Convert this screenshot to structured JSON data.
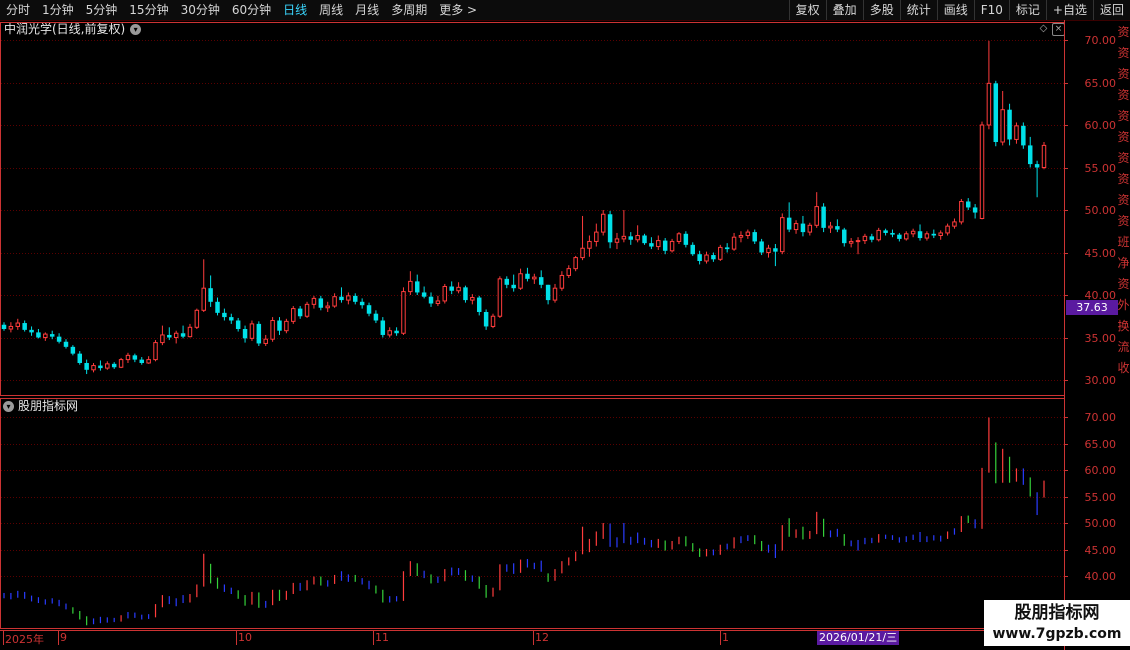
{
  "toolbar": {
    "left": [
      "分时",
      "1分钟",
      "5分钟",
      "15分钟",
      "30分钟",
      "60分钟",
      "日线",
      "周线",
      "月线",
      "多周期",
      "更多 >"
    ],
    "active_index": 6,
    "right": [
      "复权",
      "叠加",
      "多股",
      "统计",
      "画线",
      "F10",
      "标记",
      "+自选",
      "返回"
    ]
  },
  "main_chart": {
    "title": "中润光学(日线,前复权)",
    "price_tag": "37.63",
    "yticks": [
      "70.00",
      "65.00",
      "60.00",
      "55.00",
      "50.00",
      "45.00",
      "40.00",
      "35.00",
      "30.00"
    ]
  },
  "indicator": {
    "title": "股朋指标网",
    "yticks": [
      "70.00",
      "65.00",
      "60.00",
      "55.00",
      "50.00",
      "45.00",
      "40.00"
    ]
  },
  "side_strip": [
    "资",
    "资",
    "资",
    "资",
    "资",
    "资",
    "资",
    "资",
    "资",
    "资",
    "班",
    "净",
    "资",
    "外",
    "换",
    "流",
    "收"
  ],
  "timeline": {
    "labels": [
      "2025年",
      "9",
      "10",
      "11",
      "12",
      "1"
    ],
    "cursor_date": "2026/01/21/三"
  },
  "watermark": {
    "line1": "股朋指标网",
    "line2": "www.7gpzb.com"
  },
  "colors": {
    "up": "#ff3c3c",
    "down": "#00e0e8",
    "axis": "#cc3333",
    "grid": "#5a0000",
    "tag": "#5a1aa0"
  },
  "chart_data": {
    "type": "candlestick",
    "ylim": [
      29,
      71
    ],
    "candles": [
      {
        "o": 36.5,
        "h": 36.8,
        "l": 35.8,
        "c": 36.0
      },
      {
        "o": 36.0,
        "h": 36.8,
        "l": 35.6,
        "c": 36.3
      },
      {
        "o": 36.3,
        "h": 37.2,
        "l": 35.9,
        "c": 36.7
      },
      {
        "o": 36.7,
        "h": 37.0,
        "l": 35.7,
        "c": 35.9
      },
      {
        "o": 35.9,
        "h": 36.3,
        "l": 35.2,
        "c": 35.6
      },
      {
        "o": 35.6,
        "h": 36.0,
        "l": 34.9,
        "c": 35.0
      },
      {
        "o": 35.0,
        "h": 35.6,
        "l": 34.6,
        "c": 35.4
      },
      {
        "o": 35.4,
        "h": 35.8,
        "l": 34.8,
        "c": 35.1
      },
      {
        "o": 35.1,
        "h": 35.5,
        "l": 34.3,
        "c": 34.5
      },
      {
        "o": 34.5,
        "h": 34.8,
        "l": 33.7,
        "c": 33.9
      },
      {
        "o": 33.9,
        "h": 34.1,
        "l": 32.9,
        "c": 33.1
      },
      {
        "o": 33.1,
        "h": 33.4,
        "l": 31.8,
        "c": 32.0
      },
      {
        "o": 32.0,
        "h": 32.4,
        "l": 30.7,
        "c": 31.2
      },
      {
        "o": 31.2,
        "h": 32.0,
        "l": 30.9,
        "c": 31.7
      },
      {
        "o": 31.7,
        "h": 32.3,
        "l": 31.1,
        "c": 31.4
      },
      {
        "o": 31.4,
        "h": 32.2,
        "l": 31.2,
        "c": 31.9
      },
      {
        "o": 31.9,
        "h": 32.1,
        "l": 31.3,
        "c": 31.5
      },
      {
        "o": 31.5,
        "h": 32.6,
        "l": 31.4,
        "c": 32.4
      },
      {
        "o": 32.4,
        "h": 33.2,
        "l": 32.0,
        "c": 32.9
      },
      {
        "o": 32.9,
        "h": 33.1,
        "l": 32.1,
        "c": 32.4
      },
      {
        "o": 32.4,
        "h": 32.7,
        "l": 31.8,
        "c": 32.0
      },
      {
        "o": 32.0,
        "h": 32.8,
        "l": 31.9,
        "c": 32.4
      },
      {
        "o": 32.4,
        "h": 34.7,
        "l": 32.2,
        "c": 34.4
      },
      {
        "o": 34.4,
        "h": 36.4,
        "l": 34.1,
        "c": 35.3
      },
      {
        "o": 35.3,
        "h": 36.2,
        "l": 34.7,
        "c": 35.0
      },
      {
        "o": 35.0,
        "h": 35.8,
        "l": 34.3,
        "c": 35.5
      },
      {
        "o": 35.5,
        "h": 36.4,
        "l": 34.9,
        "c": 35.1
      },
      {
        "o": 35.1,
        "h": 36.6,
        "l": 35.0,
        "c": 36.2
      },
      {
        "o": 36.2,
        "h": 38.4,
        "l": 36.0,
        "c": 38.2
      },
      {
        "o": 38.2,
        "h": 44.2,
        "l": 38.0,
        "c": 40.8
      },
      {
        "o": 40.8,
        "h": 42.3,
        "l": 38.6,
        "c": 39.2
      },
      {
        "o": 39.2,
        "h": 39.7,
        "l": 37.6,
        "c": 37.9
      },
      {
        "o": 37.9,
        "h": 38.4,
        "l": 37.0,
        "c": 37.4
      },
      {
        "o": 37.4,
        "h": 37.8,
        "l": 36.6,
        "c": 37.0
      },
      {
        "o": 37.0,
        "h": 37.3,
        "l": 35.7,
        "c": 36.0
      },
      {
        "o": 36.0,
        "h": 36.4,
        "l": 34.4,
        "c": 34.9
      },
      {
        "o": 34.9,
        "h": 37.0,
        "l": 34.6,
        "c": 36.6
      },
      {
        "o": 36.6,
        "h": 36.9,
        "l": 34.0,
        "c": 34.3
      },
      {
        "o": 34.3,
        "h": 35.3,
        "l": 34.0,
        "c": 34.8
      },
      {
        "o": 34.8,
        "h": 37.4,
        "l": 34.5,
        "c": 37.0
      },
      {
        "o": 37.0,
        "h": 37.4,
        "l": 35.3,
        "c": 35.8
      },
      {
        "o": 35.8,
        "h": 37.2,
        "l": 35.5,
        "c": 36.9
      },
      {
        "o": 36.9,
        "h": 38.7,
        "l": 36.6,
        "c": 38.4
      },
      {
        "o": 38.4,
        "h": 38.7,
        "l": 37.2,
        "c": 37.5
      },
      {
        "o": 37.5,
        "h": 39.2,
        "l": 37.3,
        "c": 38.9
      },
      {
        "o": 38.9,
        "h": 39.9,
        "l": 38.4,
        "c": 39.6
      },
      {
        "o": 39.6,
        "h": 39.9,
        "l": 38.2,
        "c": 38.5
      },
      {
        "o": 38.5,
        "h": 39.2,
        "l": 38.0,
        "c": 38.7
      },
      {
        "o": 38.7,
        "h": 40.2,
        "l": 38.5,
        "c": 39.8
      },
      {
        "o": 39.8,
        "h": 40.9,
        "l": 39.1,
        "c": 39.4
      },
      {
        "o": 39.4,
        "h": 40.3,
        "l": 38.9,
        "c": 39.9
      },
      {
        "o": 39.9,
        "h": 40.2,
        "l": 38.9,
        "c": 39.2
      },
      {
        "o": 39.2,
        "h": 39.6,
        "l": 38.4,
        "c": 38.8
      },
      {
        "o": 38.8,
        "h": 39.1,
        "l": 37.5,
        "c": 37.8
      },
      {
        "o": 37.8,
        "h": 38.2,
        "l": 36.7,
        "c": 37.0
      },
      {
        "o": 37.0,
        "h": 37.4,
        "l": 35.0,
        "c": 35.3
      },
      {
        "o": 35.3,
        "h": 36.2,
        "l": 35.0,
        "c": 35.8
      },
      {
        "o": 35.8,
        "h": 36.2,
        "l": 35.2,
        "c": 35.5
      },
      {
        "o": 35.5,
        "h": 40.9,
        "l": 35.3,
        "c": 40.4
      },
      {
        "o": 40.4,
        "h": 42.8,
        "l": 40.0,
        "c": 41.6
      },
      {
        "o": 41.6,
        "h": 42.4,
        "l": 40.0,
        "c": 40.3
      },
      {
        "o": 40.3,
        "h": 41.0,
        "l": 39.6,
        "c": 39.8
      },
      {
        "o": 39.8,
        "h": 40.3,
        "l": 38.6,
        "c": 39.0
      },
      {
        "o": 39.0,
        "h": 39.9,
        "l": 38.7,
        "c": 39.3
      },
      {
        "o": 39.3,
        "h": 41.3,
        "l": 39.0,
        "c": 41.0
      },
      {
        "o": 41.0,
        "h": 41.6,
        "l": 40.1,
        "c": 40.5
      },
      {
        "o": 40.5,
        "h": 41.5,
        "l": 40.2,
        "c": 40.9
      },
      {
        "o": 40.9,
        "h": 41.1,
        "l": 39.1,
        "c": 39.4
      },
      {
        "o": 39.4,
        "h": 40.1,
        "l": 38.9,
        "c": 39.7
      },
      {
        "o": 39.7,
        "h": 39.9,
        "l": 37.6,
        "c": 38.0
      },
      {
        "o": 38.0,
        "h": 38.3,
        "l": 35.9,
        "c": 36.3
      },
      {
        "o": 36.3,
        "h": 37.8,
        "l": 36.1,
        "c": 37.5
      },
      {
        "o": 37.5,
        "h": 42.2,
        "l": 37.3,
        "c": 41.9
      },
      {
        "o": 41.9,
        "h": 42.2,
        "l": 40.8,
        "c": 41.2
      },
      {
        "o": 41.2,
        "h": 42.4,
        "l": 40.4,
        "c": 40.8
      },
      {
        "o": 40.8,
        "h": 43.1,
        "l": 40.6,
        "c": 42.5
      },
      {
        "o": 42.5,
        "h": 43.2,
        "l": 41.6,
        "c": 41.9
      },
      {
        "o": 41.9,
        "h": 42.5,
        "l": 41.3,
        "c": 42.1
      },
      {
        "o": 42.1,
        "h": 42.9,
        "l": 40.8,
        "c": 41.2
      },
      {
        "o": 41.2,
        "h": 40.5,
        "l": 38.9,
        "c": 39.4
      },
      {
        "o": 39.4,
        "h": 41.3,
        "l": 39.1,
        "c": 40.8
      },
      {
        "o": 40.8,
        "h": 42.8,
        "l": 40.5,
        "c": 42.3
      },
      {
        "o": 42.3,
        "h": 43.5,
        "l": 42.0,
        "c": 43.1
      },
      {
        "o": 43.1,
        "h": 44.6,
        "l": 42.8,
        "c": 44.4
      },
      {
        "o": 44.4,
        "h": 49.3,
        "l": 44.1,
        "c": 45.5
      },
      {
        "o": 45.5,
        "h": 47.0,
        "l": 44.5,
        "c": 46.3
      },
      {
        "o": 46.3,
        "h": 48.4,
        "l": 45.7,
        "c": 47.4
      },
      {
        "o": 47.4,
        "h": 50.0,
        "l": 47.0,
        "c": 49.5
      },
      {
        "o": 49.5,
        "h": 49.9,
        "l": 45.5,
        "c": 46.2
      },
      {
        "o": 46.2,
        "h": 47.3,
        "l": 45.4,
        "c": 46.6
      },
      {
        "o": 46.6,
        "h": 50.0,
        "l": 46.2,
        "c": 46.9
      },
      {
        "o": 46.9,
        "h": 47.4,
        "l": 45.9,
        "c": 46.5
      },
      {
        "o": 46.5,
        "h": 48.2,
        "l": 46.2,
        "c": 47.0
      },
      {
        "o": 47.0,
        "h": 47.2,
        "l": 45.9,
        "c": 46.1
      },
      {
        "o": 46.1,
        "h": 46.8,
        "l": 45.4,
        "c": 45.7
      },
      {
        "o": 45.7,
        "h": 47.0,
        "l": 45.3,
        "c": 46.4
      },
      {
        "o": 46.4,
        "h": 46.7,
        "l": 44.8,
        "c": 45.2
      },
      {
        "o": 45.2,
        "h": 46.6,
        "l": 45.0,
        "c": 46.3
      },
      {
        "o": 46.3,
        "h": 47.4,
        "l": 46.0,
        "c": 47.2
      },
      {
        "o": 47.2,
        "h": 47.5,
        "l": 45.6,
        "c": 45.9
      },
      {
        "o": 45.9,
        "h": 46.2,
        "l": 44.6,
        "c": 44.8
      },
      {
        "o": 44.8,
        "h": 45.2,
        "l": 43.6,
        "c": 44.0
      },
      {
        "o": 44.0,
        "h": 45.1,
        "l": 43.7,
        "c": 44.7
      },
      {
        "o": 44.7,
        "h": 45.0,
        "l": 43.9,
        "c": 44.2
      },
      {
        "o": 44.2,
        "h": 45.9,
        "l": 44.0,
        "c": 45.6
      },
      {
        "o": 45.6,
        "h": 46.1,
        "l": 45.0,
        "c": 45.4
      },
      {
        "o": 45.4,
        "h": 47.3,
        "l": 45.2,
        "c": 46.8
      },
      {
        "o": 46.8,
        "h": 47.5,
        "l": 46.2,
        "c": 47.0
      },
      {
        "o": 47.0,
        "h": 47.7,
        "l": 46.6,
        "c": 47.4
      },
      {
        "o": 47.4,
        "h": 47.7,
        "l": 46.0,
        "c": 46.3
      },
      {
        "o": 46.3,
        "h": 46.6,
        "l": 44.7,
        "c": 45.0
      },
      {
        "o": 45.0,
        "h": 45.9,
        "l": 44.4,
        "c": 45.5
      },
      {
        "o": 45.5,
        "h": 46.0,
        "l": 43.4,
        "c": 45.1
      },
      {
        "o": 45.1,
        "h": 49.6,
        "l": 44.8,
        "c": 49.1
      },
      {
        "o": 49.1,
        "h": 50.9,
        "l": 47.4,
        "c": 47.7
      },
      {
        "o": 47.7,
        "h": 48.8,
        "l": 47.2,
        "c": 48.4
      },
      {
        "o": 48.4,
        "h": 49.3,
        "l": 46.9,
        "c": 47.4
      },
      {
        "o": 47.4,
        "h": 48.5,
        "l": 47.0,
        "c": 48.2
      },
      {
        "o": 48.2,
        "h": 52.1,
        "l": 47.9,
        "c": 50.4
      },
      {
        "o": 50.4,
        "h": 50.8,
        "l": 47.4,
        "c": 47.9
      },
      {
        "o": 47.9,
        "h": 48.6,
        "l": 47.3,
        "c": 48.1
      },
      {
        "o": 48.1,
        "h": 48.9,
        "l": 47.4,
        "c": 47.7
      },
      {
        "o": 47.7,
        "h": 47.9,
        "l": 45.7,
        "c": 46.1
      },
      {
        "o": 46.1,
        "h": 46.7,
        "l": 45.6,
        "c": 46.3
      },
      {
        "o": 46.3,
        "h": 46.8,
        "l": 44.8,
        "c": 46.4
      },
      {
        "o": 46.4,
        "h": 47.2,
        "l": 46.0,
        "c": 46.9
      },
      {
        "o": 46.9,
        "h": 47.2,
        "l": 46.2,
        "c": 46.5
      },
      {
        "o": 46.5,
        "h": 47.9,
        "l": 46.3,
        "c": 47.6
      },
      {
        "o": 47.6,
        "h": 47.8,
        "l": 47.0,
        "c": 47.3
      },
      {
        "o": 47.3,
        "h": 47.7,
        "l": 46.8,
        "c": 47.1
      },
      {
        "o": 47.1,
        "h": 47.3,
        "l": 46.3,
        "c": 46.6
      },
      {
        "o": 46.6,
        "h": 47.5,
        "l": 46.4,
        "c": 47.2
      },
      {
        "o": 47.2,
        "h": 47.8,
        "l": 46.8,
        "c": 47.5
      },
      {
        "o": 47.5,
        "h": 48.3,
        "l": 46.4,
        "c": 46.7
      },
      {
        "o": 46.7,
        "h": 47.5,
        "l": 46.4,
        "c": 47.2
      },
      {
        "o": 47.2,
        "h": 47.7,
        "l": 46.7,
        "c": 47.0
      },
      {
        "o": 47.0,
        "h": 47.6,
        "l": 46.5,
        "c": 47.3
      },
      {
        "o": 47.3,
        "h": 48.4,
        "l": 47.0,
        "c": 48.1
      },
      {
        "o": 48.1,
        "h": 49.0,
        "l": 47.8,
        "c": 48.6
      },
      {
        "o": 48.6,
        "h": 51.3,
        "l": 48.3,
        "c": 51.0
      },
      {
        "o": 51.0,
        "h": 51.4,
        "l": 50.0,
        "c": 50.3
      },
      {
        "o": 50.3,
        "h": 50.7,
        "l": 49.0,
        "c": 49.7
      },
      {
        "o": 49.0,
        "h": 60.4,
        "l": 48.9,
        "c": 60.0
      },
      {
        "o": 60.0,
        "h": 69.9,
        "l": 59.5,
        "c": 64.9
      },
      {
        "o": 64.9,
        "h": 65.2,
        "l": 57.5,
        "c": 58.0
      },
      {
        "o": 58.0,
        "h": 64.0,
        "l": 57.6,
        "c": 61.8
      },
      {
        "o": 61.8,
        "h": 62.5,
        "l": 57.6,
        "c": 58.3
      },
      {
        "o": 58.3,
        "h": 60.3,
        "l": 57.8,
        "c": 59.9
      },
      {
        "o": 59.9,
        "h": 60.3,
        "l": 57.2,
        "c": 57.6
      },
      {
        "o": 57.6,
        "h": 58.6,
        "l": 55.0,
        "c": 55.4
      },
      {
        "o": 55.4,
        "h": 55.8,
        "l": 51.5,
        "c": 55.0
      },
      {
        "o": 55.0,
        "h": 58.0,
        "l": 54.8,
        "c": 57.6
      }
    ]
  }
}
